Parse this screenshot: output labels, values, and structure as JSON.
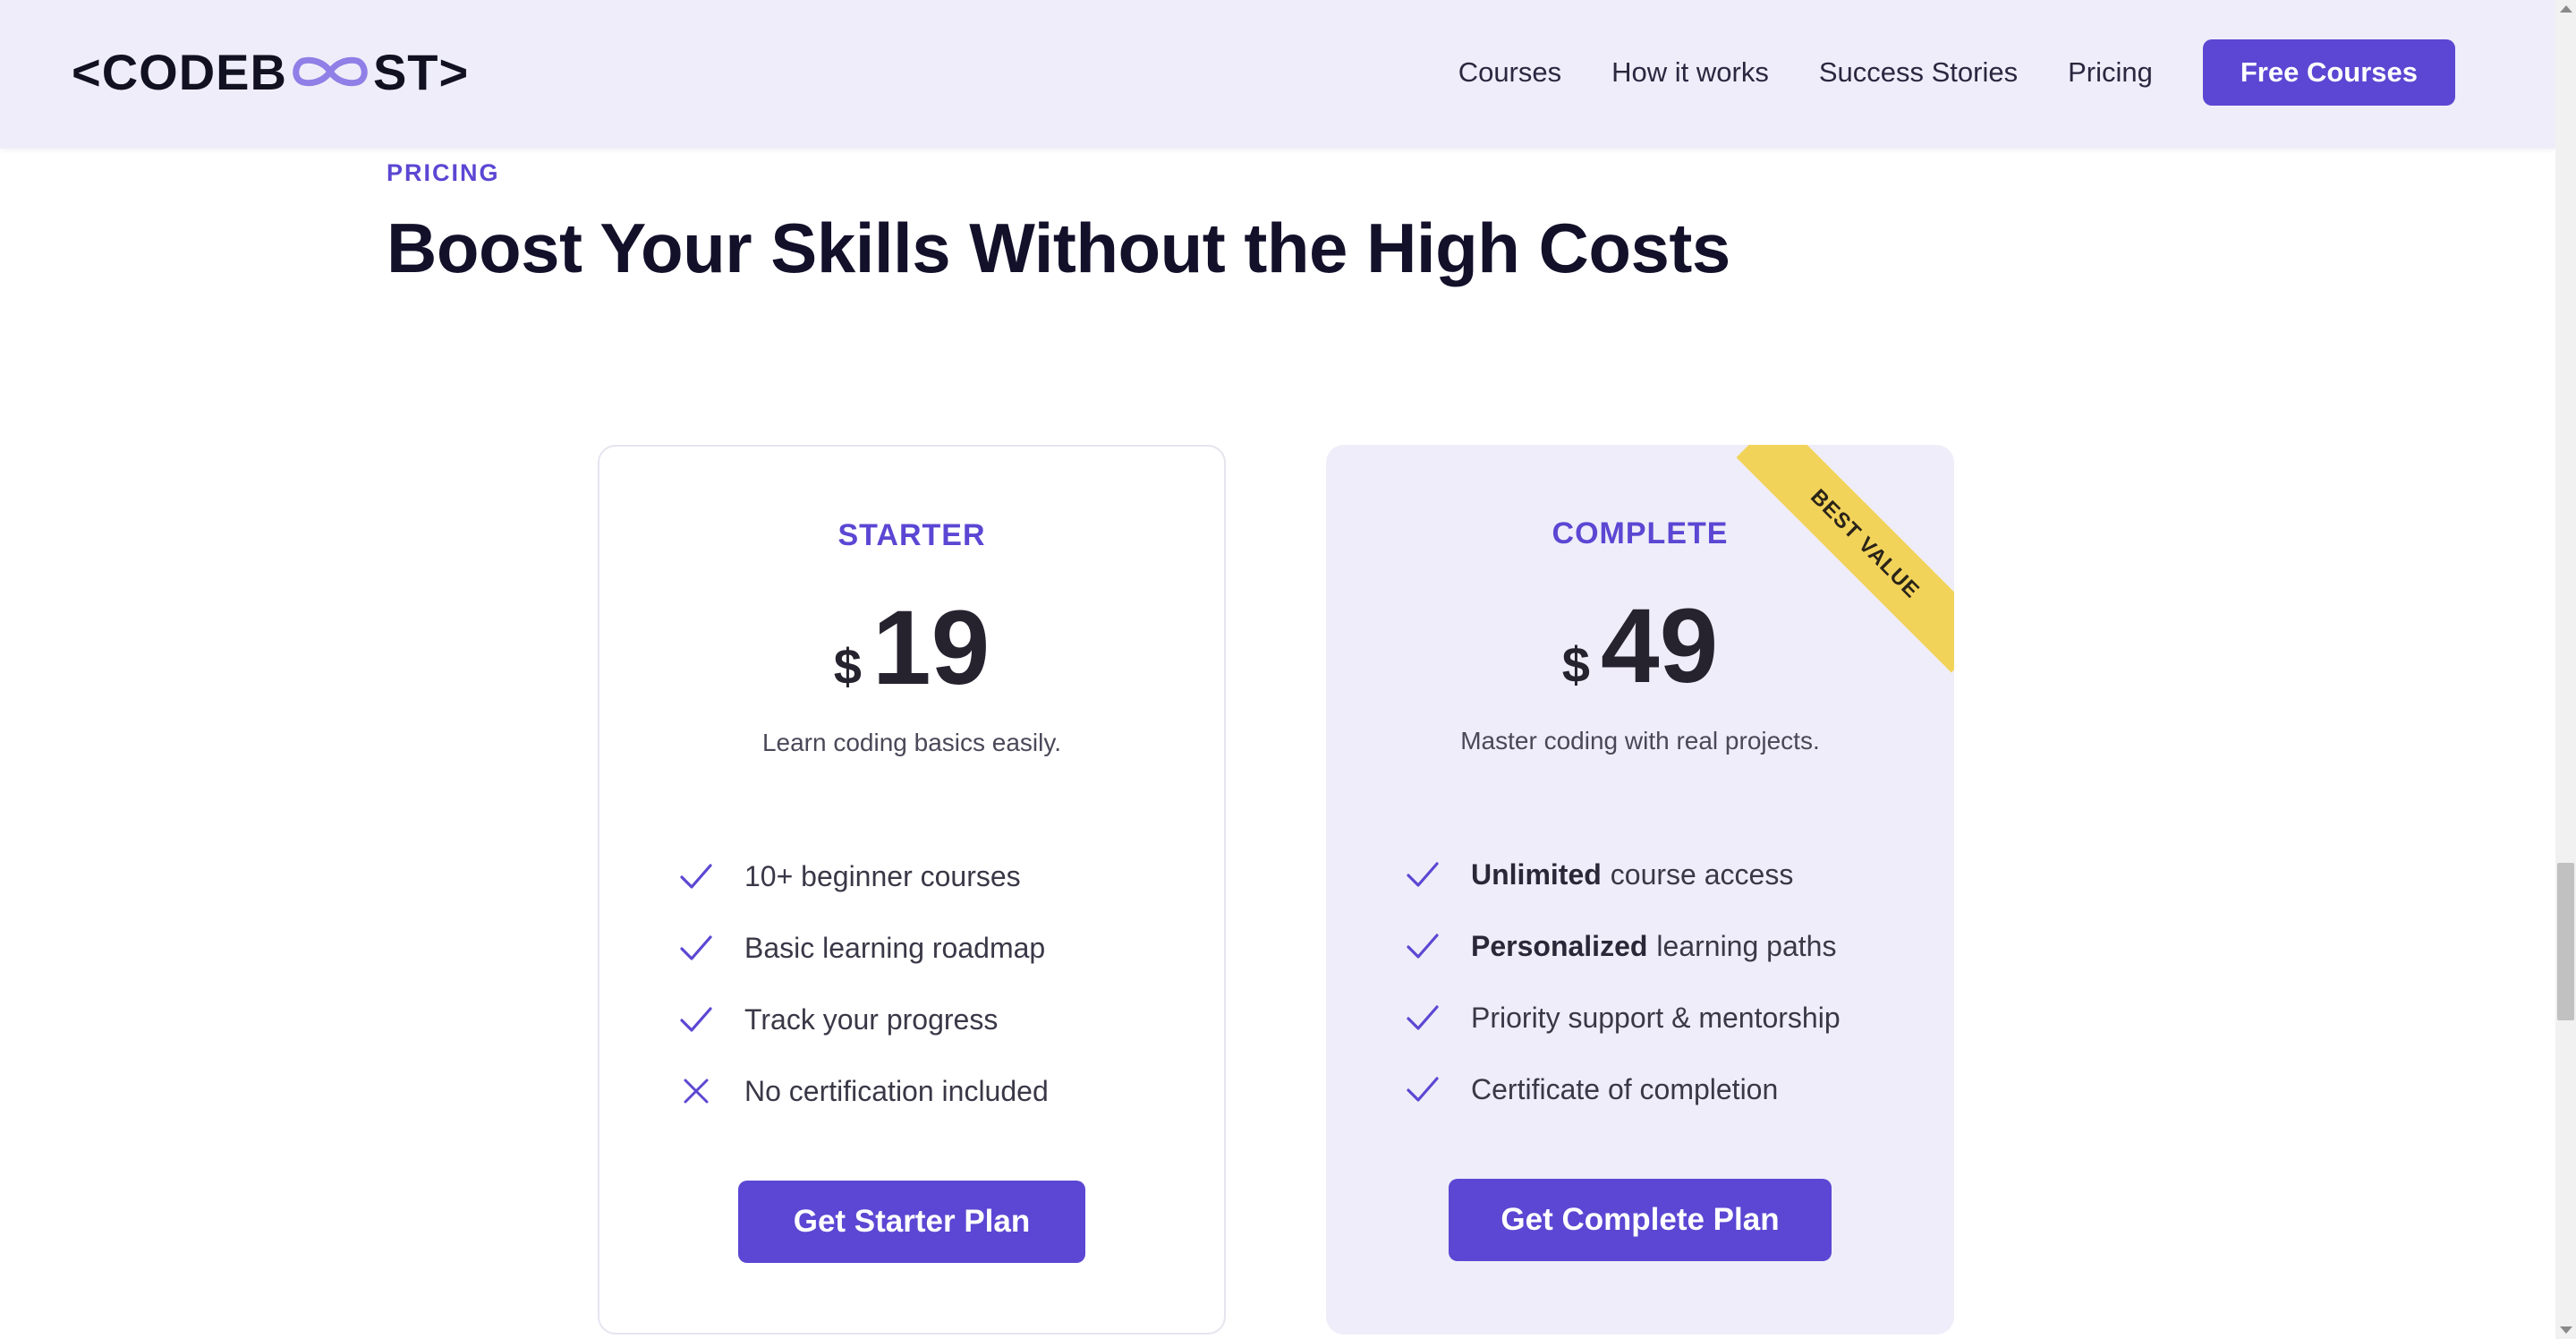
{
  "header": {
    "logo": {
      "prefix": "<CODEB",
      "suffix": "ST>",
      "infinity_color": "#8f7fe6",
      "icon": "infinity-icon"
    },
    "nav": [
      "Courses",
      "How it works",
      "Success Stories",
      "Pricing"
    ],
    "cta_label": "Free Courses"
  },
  "section": {
    "eyebrow": "PRICING",
    "headline": "Boost Your Skills Without the High Costs"
  },
  "plans": [
    {
      "name": "STARTER",
      "currency": "$",
      "price": "19",
      "tagline": "Learn coding basics easily.",
      "features": [
        {
          "bold": "",
          "text": "10+ beginner courses",
          "included": true,
          "icon": "check-icon"
        },
        {
          "bold": "",
          "text": "Basic learning roadmap",
          "included": true,
          "icon": "check-icon"
        },
        {
          "bold": "",
          "text": "Track your progress",
          "included": true,
          "icon": "check-icon"
        },
        {
          "bold": "",
          "text": "No certification included",
          "included": false,
          "icon": "x-icon"
        }
      ],
      "button_label": "Get Starter Plan"
    },
    {
      "name": "COMPLETE",
      "currency": "$",
      "price": "49",
      "tagline": "Master coding with real projects.",
      "ribbon": "BEST VALUE",
      "features": [
        {
          "bold": "Unlimited",
          "text": "course access",
          "included": true,
          "icon": "check-icon"
        },
        {
          "bold": "Personalized",
          "text": "learning paths",
          "included": true,
          "icon": "check-icon"
        },
        {
          "bold": "",
          "text": "Priority support & mentorship",
          "included": true,
          "icon": "check-icon"
        },
        {
          "bold": "",
          "text": "Certificate of completion",
          "included": true,
          "icon": "check-icon"
        }
      ],
      "button_label": "Get Complete Plan"
    }
  ],
  "colors": {
    "accent": "#5b47d3",
    "header_bg": "#efedf9",
    "ribbon": "#f2d35a"
  }
}
